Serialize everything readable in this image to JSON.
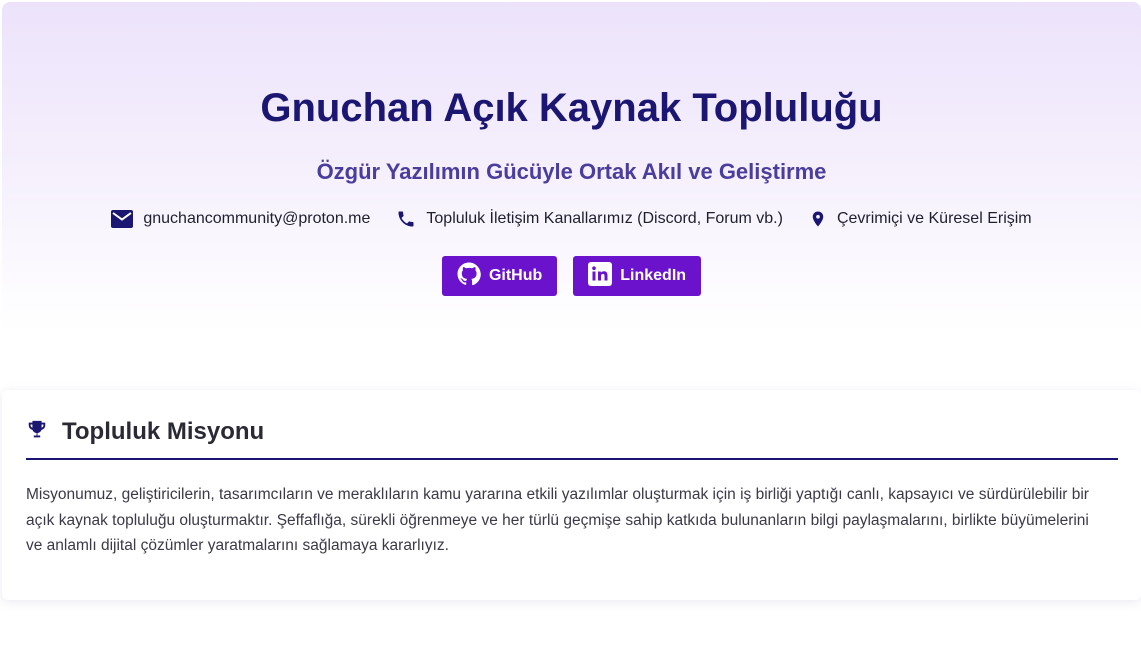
{
  "hero": {
    "title": "Gnuchan Açık Kaynak Topluluğu",
    "subtitle": "Özgür Yazılımın Gücüyle Ortak Akıl ve Geliştirme",
    "contacts": [
      {
        "icon": "mail-icon",
        "text": "gnuchancommunity@proton.me"
      },
      {
        "icon": "phone-icon",
        "text": "Topluluk İletişim Kanallarımız (Discord, Forum vb.)"
      },
      {
        "icon": "location-icon",
        "text": "Çevrimiçi ve Küresel Erişim"
      }
    ],
    "buttons": [
      {
        "icon": "github-icon",
        "label": "GitHub"
      },
      {
        "icon": "linkedin-icon",
        "label": "LinkedIn"
      }
    ]
  },
  "mission": {
    "icon": "trophy-icon",
    "title": "Topluluk Misyonu",
    "text": "Misyonumuz, geliştiricilerin, tasarımcıların ve meraklıların kamu yararına etkili yazılımlar oluşturmak için iş birliği yaptığı canlı, kapsayıcı ve sürdürülebilir bir açık kaynak topluluğu oluşturmaktır. Şeffaflığa, sürekli öğrenmeye ve her türlü geçmişe sahip katkıda bulunanların bilgi paylaşmalarını, birlikte büyümelerini ve anlamlı dijital çözümler yaratmalarını sağlamaya kararlıyız."
  },
  "colors": {
    "title": "#1c1673",
    "subtitle": "#4b3d9e",
    "button": "#6a12cc",
    "divider": "#1c1673"
  }
}
